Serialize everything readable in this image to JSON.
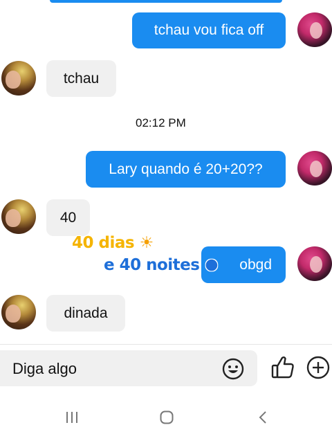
{
  "messages": [
    {
      "id": "out1",
      "text": "tchau vou fica off"
    },
    {
      "id": "in1",
      "text": "tchau"
    },
    {
      "id": "out2",
      "text": "Lary quando é 20+20??"
    },
    {
      "id": "in2",
      "text": "40"
    },
    {
      "id": "out3",
      "text": "obgd"
    },
    {
      "id": "in3",
      "text": "dinada"
    }
  ],
  "timestamp": "02:12 PM",
  "overlay": {
    "line1": "40 dias",
    "line1_emoji": "☀",
    "line2": "e 40 noites",
    "line2_emoji": "🌑"
  },
  "composer": {
    "placeholder": "Diga algo",
    "emoji_icon": "smiley-icon",
    "like_icon": "thumbs-up-icon",
    "add_icon": "plus-circle-icon"
  },
  "colors": {
    "outgoing": "#1a8cf0",
    "incoming": "#f0f0f0",
    "overlay_line1": "#f5b400",
    "overlay_line2": "#1e6fd9"
  }
}
